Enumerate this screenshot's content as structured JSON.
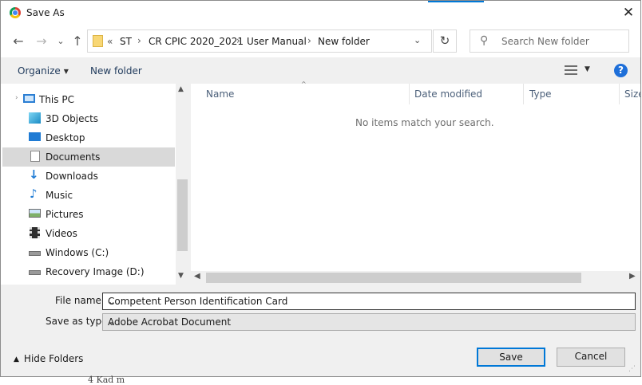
{
  "window": {
    "title": "Save As",
    "close_label": "✕"
  },
  "nav": {
    "back_label": "←",
    "forward_label": "→",
    "recent_label": "⌄",
    "up_label": "↑",
    "refresh_label": "↻"
  },
  "address": {
    "overflow": "«",
    "crumbs": [
      "ST",
      "CR CPIC 2020_2021",
      "User Manual",
      "New folder"
    ],
    "separator": "›",
    "dropdown": "⌄"
  },
  "search": {
    "icon": "search-icon",
    "placeholder": "Search New folder"
  },
  "toolbar": {
    "organize_label": "Organize",
    "new_folder_label": "New folder",
    "help_label": "?"
  },
  "tree": {
    "items": [
      {
        "label": "This PC",
        "icon": "computer-icon"
      },
      {
        "label": "3D Objects",
        "icon": "cube-icon"
      },
      {
        "label": "Desktop",
        "icon": "desktop-icon"
      },
      {
        "label": "Documents",
        "icon": "documents-icon",
        "selected": true
      },
      {
        "label": "Downloads",
        "icon": "download-icon"
      },
      {
        "label": "Music",
        "icon": "music-icon"
      },
      {
        "label": "Pictures",
        "icon": "pictures-icon"
      },
      {
        "label": "Videos",
        "icon": "videos-icon"
      },
      {
        "label": "Windows (C:)",
        "icon": "drive-icon"
      },
      {
        "label": "Recovery Image (D:)",
        "icon": "drive-icon"
      }
    ]
  },
  "list": {
    "columns": [
      "Name",
      "Date modified",
      "Type",
      "Size"
    ],
    "empty_message": "No items match your search."
  },
  "form": {
    "file_name_label": "File name:",
    "file_name_value": "Competent Person Identification Card",
    "save_type_label": "Save as type:",
    "save_type_value": "Adobe Acrobat Document"
  },
  "footer": {
    "hide_folders_label": "Hide Folders",
    "save_label": "Save",
    "cancel_label": "Cancel"
  },
  "background": {
    "partial_text": "4  Kad m"
  },
  "colors": {
    "accent": "#0078d7",
    "selection": "#d9d9d9",
    "header_text": "#4c607a",
    "link_text": "#1e395b"
  }
}
